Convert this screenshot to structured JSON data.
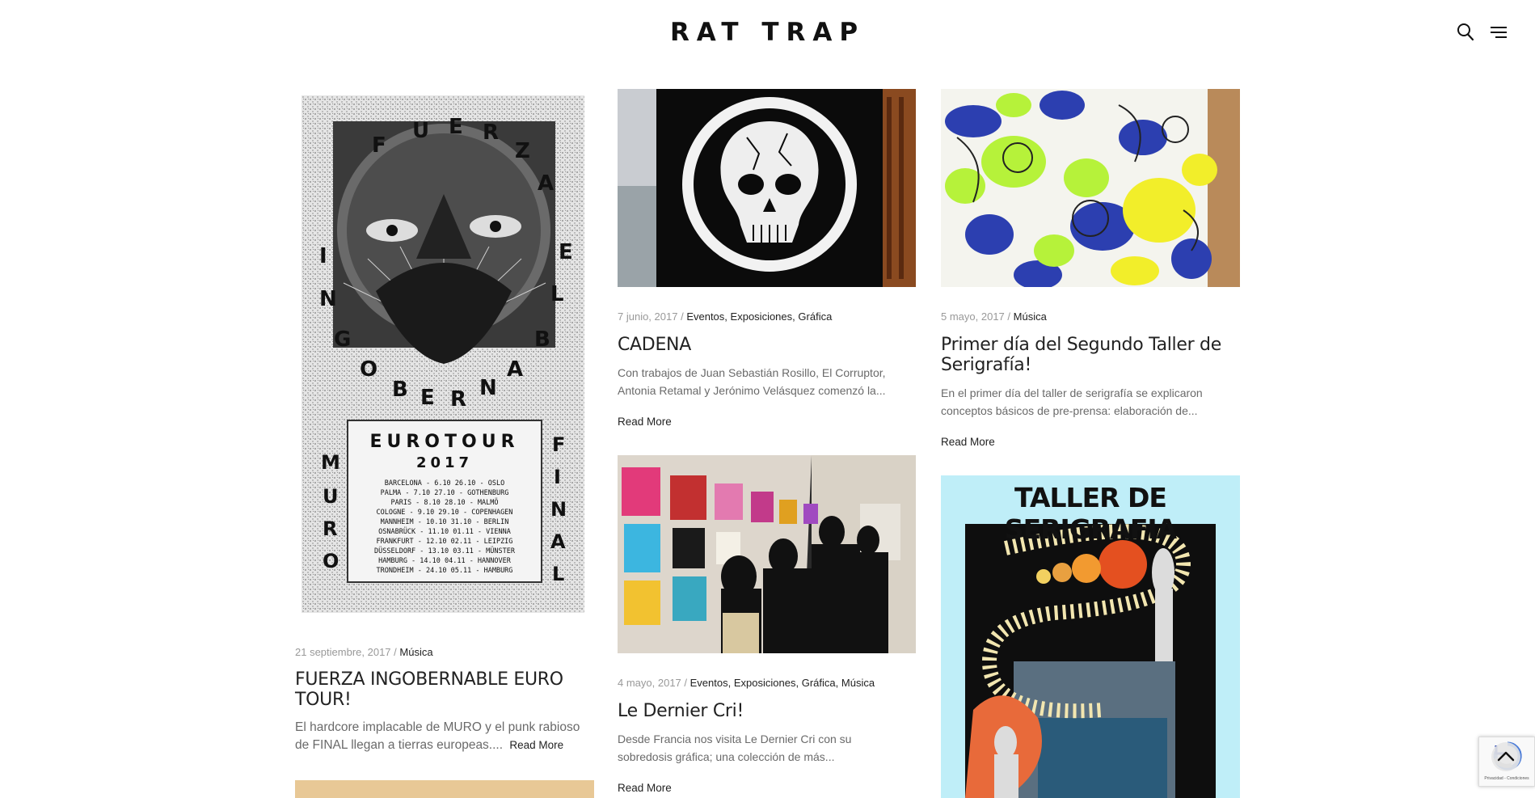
{
  "site": {
    "logo": "RAT TRAP"
  },
  "header": {
    "search_icon": "search-icon",
    "menu_icon": "hamburger-menu-icon"
  },
  "posts": [
    {
      "date": "21 septiembre, 2017",
      "categories": [
        "Música"
      ],
      "title": "FUERZA INGOBERNABLE EURO TOUR!",
      "excerpt": "El hardcore implacable de MURO y el punk rabioso de FINAL llegan a tierras europeas....",
      "read_more": "Read More",
      "poster": {
        "top_word": "FUERZA",
        "left_word": "INGOBERNABLE",
        "right_word": "EL",
        "center_word": "GOBERNAR",
        "tour": "EUROTOUR",
        "year": "2017",
        "band_left": "MURO",
        "band_right": "FINAL",
        "dates": [
          "BARCELONA - 6.10  26.10 - OSLO",
          "PALMA - 7.10  27.10 - GOTHENBURG",
          "PARIS - 8.10  28.10 - MALMÖ",
          "COLOGNE - 9.10  29.10 - COPENHAGEN",
          "MANNHEIM - 10.10  31.10 - BERLIN",
          "OSNABRÜCK - 11.10  01.11 - VIENNA",
          "FRANKFURT - 12.10  02.11 - LEIPZIG",
          "DÜSSELDORF - 13.10  03.11 - MÜNSTER",
          "HAMBURG - 14.10  04.11 - HANNOVER",
          "TRONDHEIM - 24.10  05.11 - HAMBURG"
        ]
      }
    },
    {
      "date": "7 junio, 2017",
      "categories": [
        "Eventos",
        "Exposiciones",
        "Gráfica"
      ],
      "title": "CADENA",
      "excerpt": "Con trabajos de Juan Sebastián Rosillo, El Corruptor, Antonia Retamal y Jerónimo Velásquez comenzó la...",
      "read_more": "Read More"
    },
    {
      "date": "5 mayo, 2017",
      "categories": [
        "Música"
      ],
      "title": "Primer día del Segundo Taller de Serigrafía!",
      "excerpt": "En el primer día del taller de serigrafía se explicaron conceptos básicos de pre-prensa: elaboración de...",
      "read_more": "Read More"
    },
    {
      "date": "4 mayo, 2017",
      "categories": [
        "Eventos",
        "Exposiciones",
        "Gráfica",
        "Música"
      ],
      "title": "Le Dernier Cri!",
      "excerpt": "Desde Francia nos visita Le Dernier Cri con su sobredosis gráfica; una colección de más...",
      "read_more": "Read More"
    },
    {
      "poster_title": "TALLER DE SERIGRAFIA"
    }
  ],
  "recaptcha": {
    "terms": "Privacidad - Condiciones"
  },
  "colors": {
    "text": "#222222",
    "muted": "#999999",
    "excerpt": "#6a6a6a",
    "serigrafia_bg": "#bfeef8"
  }
}
